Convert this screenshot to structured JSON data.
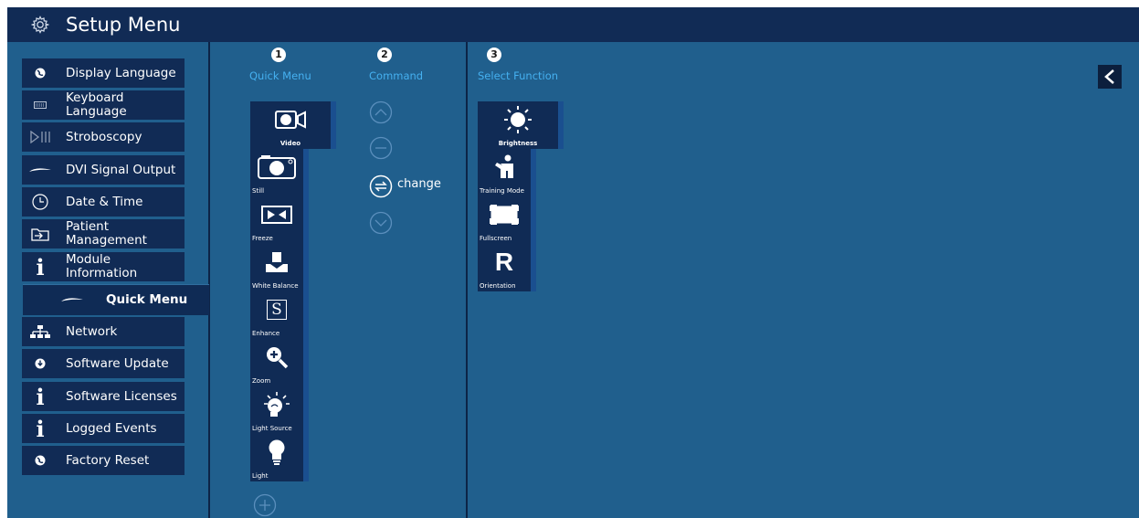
{
  "title": "Setup Menu",
  "sidebar": {
    "items": [
      {
        "label": "Display Language",
        "icon": "globe-icon"
      },
      {
        "label": "Keyboard Language",
        "icon": "keyboard-icon"
      },
      {
        "label": "Stroboscopy",
        "icon": "stroboscopy-icon"
      },
      {
        "label": "DVI Signal Output",
        "icon": "signal-icon"
      },
      {
        "label": "Date & Time",
        "icon": "clock-icon"
      },
      {
        "label": "Patient Management",
        "icon": "patient-folder-icon"
      },
      {
        "label": "Module Information",
        "icon": "info-icon"
      },
      {
        "label": "Quick Menu",
        "icon": "quick-menu-icon",
        "selected": true
      },
      {
        "label": "Network",
        "icon": "network-icon"
      },
      {
        "label": "Software Update",
        "icon": "download-icon"
      },
      {
        "label": "Software Licenses",
        "icon": "info-icon"
      },
      {
        "label": "Logged Events",
        "icon": "info-icon"
      },
      {
        "label": "Factory Reset",
        "icon": "reset-icon"
      }
    ]
  },
  "columns": [
    {
      "number": "1",
      "header": "Quick Menu"
    },
    {
      "number": "2",
      "header": "Command"
    },
    {
      "number": "3",
      "header": "Select Function"
    }
  ],
  "quick_menu": [
    {
      "label": "Video",
      "icon": "video-camera-icon",
      "selected": true
    },
    {
      "label": "Still",
      "icon": "camera-icon"
    },
    {
      "label": "Freeze",
      "icon": "freeze-icon"
    },
    {
      "label": "White Balance",
      "icon": "white-balance-icon"
    },
    {
      "label": "Enhance",
      "icon": "enhance-icon"
    },
    {
      "label": "Zoom",
      "icon": "zoom-icon"
    },
    {
      "label": "Light Source",
      "icon": "light-source-icon"
    },
    {
      "label": "Light",
      "icon": "bulb-icon"
    }
  ],
  "commands": {
    "change_label": "change"
  },
  "functions": [
    {
      "label": "Brightness",
      "icon": "sun-icon",
      "selected": true
    },
    {
      "label": "Training Mode",
      "icon": "training-icon"
    },
    {
      "label": "Fullscreen",
      "icon": "fullscreen-icon"
    },
    {
      "label": "Orientation",
      "icon": "orientation-icon",
      "glyph": "R"
    }
  ],
  "colors": {
    "background": "#205f8d",
    "panel": "#112b55",
    "accent": "#45b0f0"
  }
}
